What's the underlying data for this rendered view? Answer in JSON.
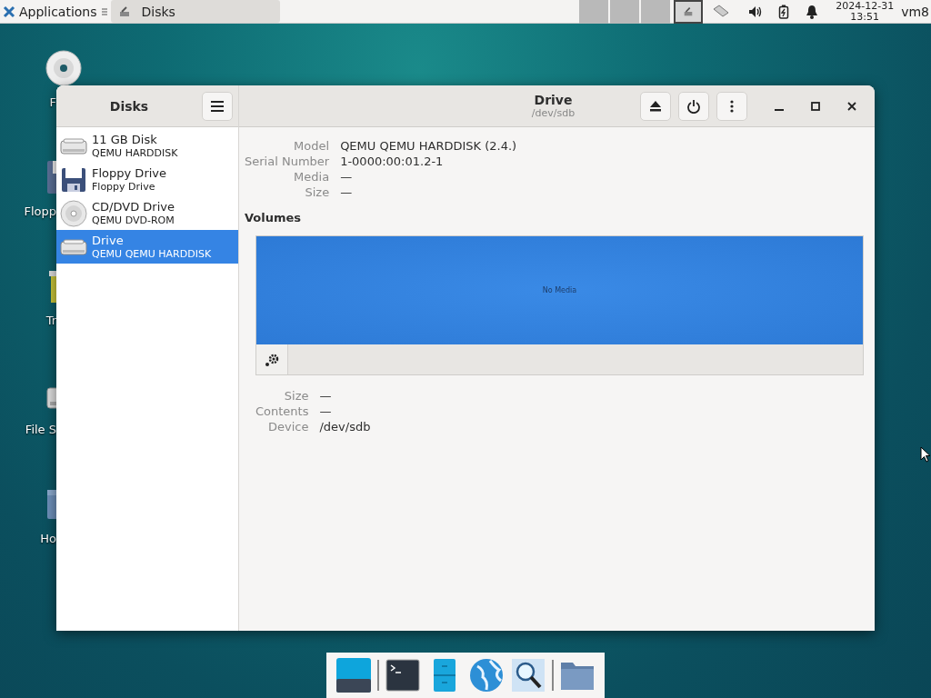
{
  "panel": {
    "apps_label": "Applications",
    "taskbar": [
      {
        "title": "Disks",
        "selected": false
      }
    ],
    "workspaces": [
      {
        "selected": false
      },
      {
        "selected": false
      },
      {
        "selected": false
      },
      {
        "selected": true
      }
    ],
    "clock": {
      "date": "2024-12-31",
      "time": "13:51"
    },
    "user": "vm8"
  },
  "desktop_icons": [
    {
      "label": "F",
      "kind": "disc"
    },
    {
      "label": "Flopp",
      "kind": "floppy"
    },
    {
      "label": "Tr",
      "kind": "trash"
    },
    {
      "label": "File S",
      "kind": "drive"
    },
    {
      "label": "Ho",
      "kind": "folder"
    }
  ],
  "window": {
    "title": "Disks",
    "sidebar": {
      "items": [
        {
          "name": "11 GB Disk",
          "model": "QEMU HARDDISK",
          "kind": "hdd",
          "selected": false
        },
        {
          "name": "Floppy Drive",
          "model": "Floppy Drive",
          "kind": "floppy",
          "selected": false
        },
        {
          "name": "CD/DVD Drive",
          "model": "QEMU DVD-ROM",
          "kind": "optical",
          "selected": false
        },
        {
          "name": "Drive",
          "model": "QEMU QEMU HARDDISK",
          "kind": "hdd",
          "selected": true
        }
      ]
    },
    "drive": {
      "title": "Drive",
      "subtitle": "/dev/sdb",
      "info": [
        {
          "label": "Model",
          "value": "QEMU QEMU HARDDISK (2.4.)"
        },
        {
          "label": "Serial Number",
          "value": "1-0000:00:01.2-1"
        },
        {
          "label": "Media",
          "value": "—"
        },
        {
          "label": "Size",
          "value": "—"
        }
      ],
      "volumes_heading": "Volumes",
      "volume_map_text": "No Media",
      "volume_info": [
        {
          "label": "Size",
          "value": "—"
        },
        {
          "label": "Contents",
          "value": "—"
        },
        {
          "label": "Device",
          "value": "/dev/sdb"
        }
      ]
    }
  },
  "dock": [
    {
      "kind": "desktop"
    },
    {
      "kind": "terminal"
    },
    {
      "kind": "files-cabinet"
    },
    {
      "kind": "globe"
    },
    {
      "kind": "search"
    },
    {
      "kind": "folder"
    }
  ]
}
